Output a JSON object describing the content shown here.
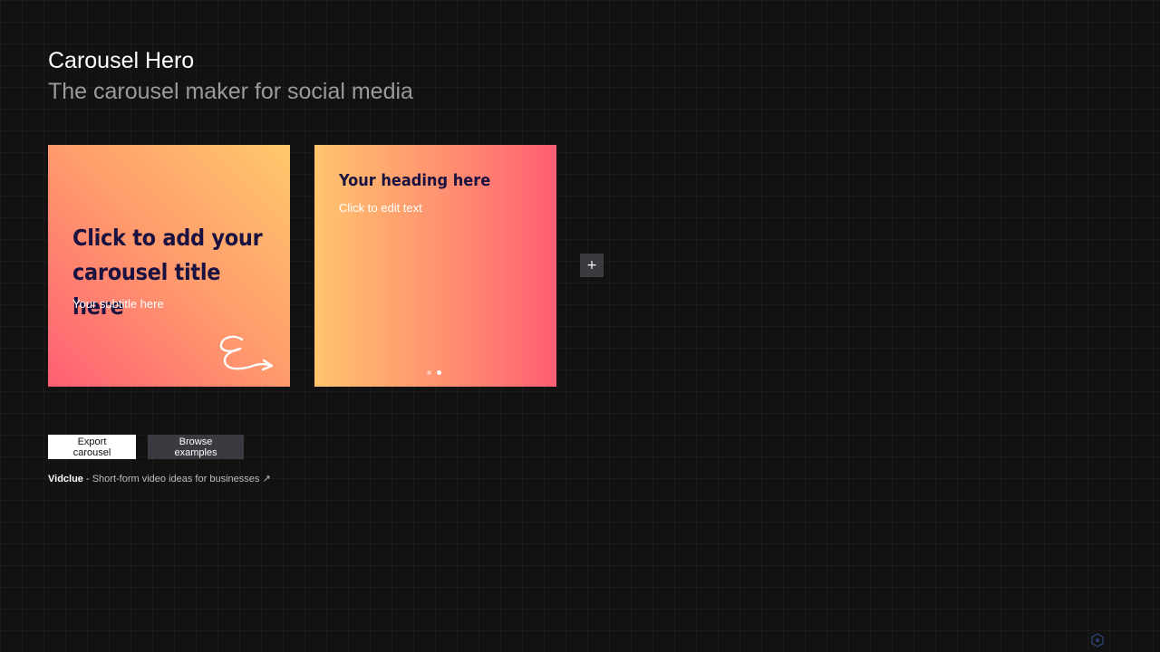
{
  "header": {
    "title": "Carousel Hero",
    "subtitle": "The carousel maker for social media"
  },
  "slides": [
    {
      "title": "Click to add your carousel title here",
      "subtitle": "Your subtitle here",
      "icon": "swipe-arrow-icon"
    },
    {
      "heading": "Your heading here",
      "body": "Click to edit text",
      "pagination": {
        "total": 2,
        "active": 2
      }
    }
  ],
  "add_slide": {
    "label": "+"
  },
  "actions": {
    "export_label": "Export carousel",
    "browse_label": "Browse examples"
  },
  "footer": {
    "brand": "Vidclue",
    "separator": " - ",
    "link_text": "Short-form video ideas for businesses",
    "link_icon": "↗"
  },
  "colors": {
    "background": "#121212",
    "title_text": "#1a1240",
    "slide_gradient_pink": "#ff5f74",
    "slide_gradient_yellow": "#ffc86c",
    "secondary_button": "#3a3a40"
  }
}
